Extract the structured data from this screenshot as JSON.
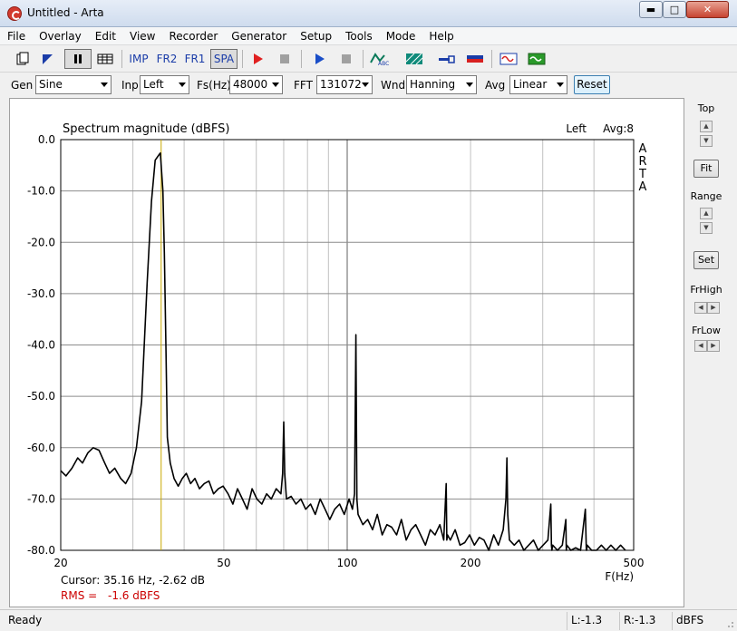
{
  "window": {
    "title": "Untitled - Arta"
  },
  "menu": [
    "File",
    "Overlay",
    "Edit",
    "View",
    "Recorder",
    "Generator",
    "Setup",
    "Tools",
    "Mode",
    "Help"
  ],
  "toolbar": {
    "imp": "IMP",
    "fr2": "FR2",
    "fr1": "FR1",
    "spa": "SPA"
  },
  "params": {
    "gen_label": "Gen",
    "gen_value": "Sine",
    "inp_label": "Inp",
    "inp_value": "Left",
    "fs_label": "Fs(Hz)",
    "fs_value": "48000",
    "fft_label": "FFT",
    "fft_value": "131072",
    "wnd_label": "Wnd",
    "wnd_value": "Hanning",
    "avg_label": "Avg",
    "avg_value": "Linear",
    "reset_label": "Reset"
  },
  "plot": {
    "channel": "Left",
    "avg": "Avg:8",
    "watermark": [
      "A",
      "R",
      "T",
      "A"
    ],
    "cursor_text": "Cursor: 35.16 Hz, -2.62 dB",
    "rms_label": "RMS =",
    "rms_value": "-1.6 dBFS"
  },
  "side": {
    "top_label": "Top",
    "fit_label": "Fit",
    "range_label": "Range",
    "set_label": "Set",
    "frhigh_label": "FrHigh",
    "frlow_label": "FrLow"
  },
  "status": {
    "ready": "Ready",
    "left": "L:-1.3",
    "right": "R:-1.3",
    "unit": "dBFS"
  },
  "colors": {
    "trace": "#000000",
    "cursor": "#c8a800",
    "grid": "#8c8c8c",
    "rms": "#cc0000"
  },
  "chart_data": {
    "type": "line",
    "title": "Spectrum magnitude (dBFS)",
    "xlabel": "F(Hz)",
    "ylabel": "",
    "xscale": "log",
    "xlim": [
      20,
      500
    ],
    "ylim": [
      -80,
      0
    ],
    "xticks": [
      "20",
      "50",
      "100",
      "200",
      "500"
    ],
    "yticks": [
      "0.0",
      "-10.0",
      "-20.0",
      "-30.0",
      "-40.0",
      "-50.0",
      "-60.0",
      "-70.0",
      "-80.0"
    ],
    "grid": true,
    "cursor_x": 35.16,
    "series": [
      {
        "values_x": [
          20,
          20.6,
          21.3,
          22,
          22.6,
          23.3,
          24,
          24.8,
          25.6,
          26.3,
          27.1,
          28,
          28.8,
          29.7,
          30.6,
          31.5,
          32.5,
          33.3,
          34.0,
          34.7,
          35.0,
          35.16,
          35.5,
          35.8,
          36.1,
          36.4,
          37.0,
          37.8,
          38.7,
          39.6,
          40.5,
          41.5,
          42.5,
          43.6,
          44.8,
          46,
          47.2,
          48.5,
          49.8,
          51.2,
          52.6,
          54,
          55.5,
          57,
          58.6,
          60.2,
          61.9,
          63.6,
          65.3,
          67.1,
          68.9,
          69.6,
          70.0,
          70.4,
          71.1,
          73.0,
          75.0,
          77.1,
          79.2,
          81.4,
          83.6,
          85.9,
          88.3,
          90.7,
          93.2,
          95.8,
          98.4,
          101.1,
          103.0,
          104.2,
          105.0,
          105.6,
          106.3,
          109.2,
          112.2,
          115.3,
          118.4,
          121.7,
          125,
          128.4,
          132,
          135.6,
          139.3,
          143.1,
          147,
          151.1,
          155.2,
          159.5,
          163.8,
          168.3,
          172.0,
          174.4,
          175.0,
          175.7,
          178.5,
          183.4,
          188.4,
          193.6,
          198.9,
          204.3,
          210,
          215.7,
          221.6,
          227.7,
          233.9,
          240.3,
          243.9,
          245.3,
          246.5,
          248.8,
          255.6,
          262.6,
          269.8,
          277.2,
          284.8,
          292.6,
          300.6,
          308.8,
          313.9,
          315.0,
          315.8,
          317.3,
          326,
          334.9,
          341.6,
          342.5,
          343.3,
          351.4,
          361,
          371,
          381.1,
          383.2,
          384.1,
          385.0,
          395,
          405.8,
          417,
          428.4,
          440.1,
          452.2,
          464.6,
          477.3,
          490.4,
          500
        ],
        "values_y": [
          -64.5,
          -65.5,
          -64,
          -62,
          -63,
          -61,
          -60,
          -60.5,
          -63,
          -65,
          -64,
          -66,
          -67,
          -65,
          -60,
          -51,
          -28,
          -12,
          -4,
          -3,
          -2.62,
          -5,
          -10,
          -22,
          -40,
          -58,
          -63,
          -66,
          -67.5,
          -66,
          -65,
          -67,
          -66,
          -68,
          -67,
          -66.5,
          -69,
          -68,
          -67.5,
          -69,
          -71,
          -68,
          -70,
          -72,
          -68,
          -70,
          -71,
          -69,
          -70,
          -68,
          -69,
          -65,
          -55,
          -65,
          -70,
          -69.5,
          -71,
          -70,
          -72,
          -71,
          -73,
          -70,
          -72,
          -74,
          -72,
          -71,
          -73,
          -70,
          -72,
          -69,
          -38,
          -70,
          -73,
          -75,
          -74,
          -76,
          -73,
          -77,
          -75,
          -75.5,
          -77,
          -74,
          -78,
          -76,
          -75,
          -77,
          -79,
          -76,
          -77,
          -75,
          -78,
          -67,
          -78,
          -77,
          -78,
          -76,
          -79,
          -78.5,
          -77,
          -79,
          -77.5,
          -78,
          -80,
          -77,
          -79,
          -76,
          -70,
          -62,
          -73,
          -78,
          -79,
          -78,
          -80,
          -79,
          -78,
          -80,
          -79,
          -78,
          -71,
          -79,
          -80,
          -79,
          -80,
          -79,
          -74,
          -80,
          -79,
          -80,
          -79.5,
          -80,
          -72,
          -80,
          -80,
          -79,
          -80,
          -80,
          -79,
          -80,
          -79,
          -80,
          -79,
          -80
        ]
      }
    ]
  }
}
